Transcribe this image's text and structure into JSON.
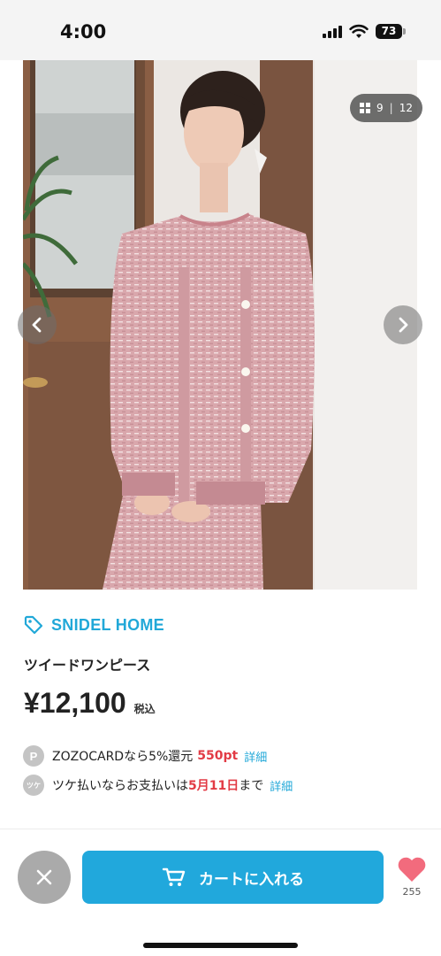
{
  "status_bar": {
    "time": "4:00",
    "battery_level": "73",
    "icons": [
      "signal-icon",
      "wifi-icon",
      "battery-icon"
    ]
  },
  "gallery": {
    "counter_current": "9",
    "counter_total": "12",
    "counter_separator": "|",
    "icons": [
      "grid-icon",
      "chevron-left-icon",
      "chevron-right-icon"
    ]
  },
  "product": {
    "brand": "SNIDEL HOME",
    "name": "ツイードワンピース",
    "price": "¥12,100",
    "tax_label": "税込"
  },
  "zozocard": {
    "icon_letter": "P",
    "text": "ZOZOCARDなら5%還元",
    "points": "550pt",
    "detail_link": "詳細"
  },
  "tsuke": {
    "icon_text": "ツケ",
    "text_before": "ツケ払いならお支払いは",
    "date": "5月11日",
    "text_after": "まで",
    "detail_link": "詳細"
  },
  "actions": {
    "cart_button_label": "カートに入れる",
    "favorite_count": "255",
    "icons": [
      "close-icon",
      "cart-icon",
      "heart-icon"
    ]
  },
  "colors": {
    "accent_blue": "#21a8dc",
    "highlight_red": "#e23b45",
    "heart_pink": "#f26b7d",
    "neutral_gray": "#aaaaaa"
  }
}
